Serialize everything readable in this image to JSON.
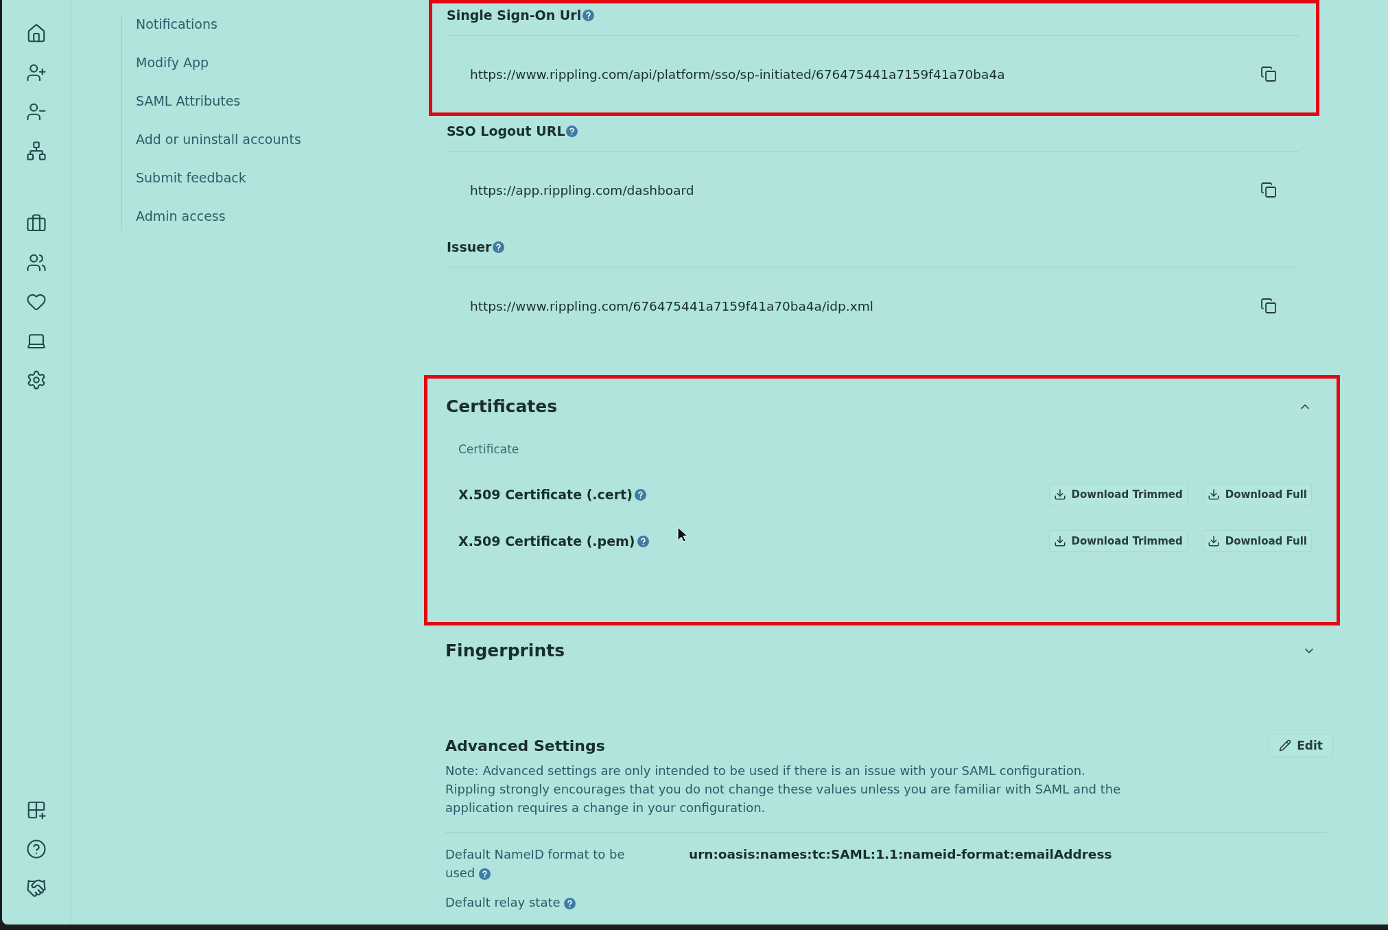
{
  "nav": [
    {
      "label": "Notifications"
    },
    {
      "label": "Modify App"
    },
    {
      "label": "SAML Attributes"
    },
    {
      "label": "Add or uninstall accounts"
    },
    {
      "label": "Submit feedback"
    },
    {
      "label": "Admin access"
    }
  ],
  "fields": [
    {
      "label": "Single Sign-On Url",
      "value": "https://www.rippling.com/api/platform/sso/sp-initiated/676475441a7159f41a70ba4a",
      "highlighted": true
    },
    {
      "label": "SSO Logout URL",
      "value": "https://app.rippling.com/dashboard",
      "highlighted": false
    },
    {
      "label": "Issuer",
      "value": "https://www.rippling.com/676475441a7159f41a70ba4a/idp.xml",
      "highlighted": false
    }
  ],
  "certificates": {
    "title": "Certificates",
    "expanded": true,
    "highlighted": true,
    "column": "Certificate",
    "rows": [
      {
        "name": "X.509 Certificate (.cert)",
        "buttons": [
          "Download Trimmed",
          "Download Full"
        ]
      },
      {
        "name": "X.509 Certificate (.pem)",
        "buttons": [
          "Download Trimmed",
          "Download Full"
        ]
      }
    ]
  },
  "fingerprints": {
    "title": "Fingerprints",
    "expanded": false
  },
  "advanced": {
    "title": "Advanced Settings",
    "edit": "Edit",
    "note": "Note: Advanced settings are only intended to be used if there is an issue with your SAML configuration. Rippling strongly encourages that you do not change these values unless you are familiar with SAML and the application requires a change in your configuration.",
    "settings": [
      {
        "label": "Default NameID format to be used",
        "value": "urn:oasis:names:tc:SAML:1.1:nameid-format:emailAddress"
      },
      {
        "label": "Default relay state"
      }
    ]
  }
}
